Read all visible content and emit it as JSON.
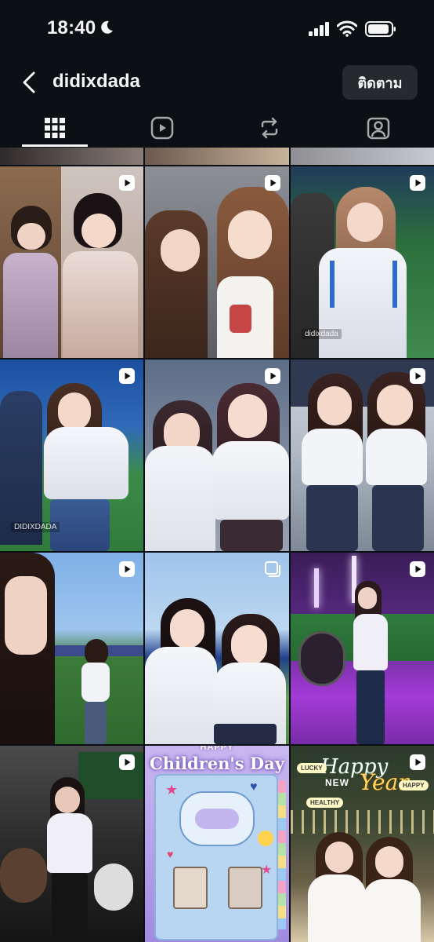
{
  "status_bar": {
    "time": "18:40"
  },
  "header": {
    "username": "didixdada",
    "follow_label": "ติดตาม"
  },
  "tabs": [
    {
      "id": "posts",
      "icon": "grid-icon",
      "active": true
    },
    {
      "id": "reels",
      "icon": "reels-icon",
      "active": false
    },
    {
      "id": "reposts",
      "icon": "repost-icon",
      "active": false
    },
    {
      "id": "tagged",
      "icon": "tagged-person-icon",
      "active": false
    }
  ],
  "posts": [
    {
      "type": "reel",
      "colors": [
        "#d7cdc9",
        "#8a6a52"
      ],
      "caption": ""
    },
    {
      "type": "reel",
      "colors": [
        "#c9b9ae",
        "#7d6b62"
      ],
      "caption": ""
    },
    {
      "type": "reel",
      "colors": [
        "#2c6f3d",
        "#d9dce6"
      ],
      "caption": "didixdada"
    },
    {
      "type": "reel",
      "colors": [
        "#1c4fa0",
        "#3c8a4a"
      ],
      "caption": "DIDIXDADA"
    },
    {
      "type": "reel",
      "colors": [
        "#5e6d86",
        "#e8e8ee"
      ],
      "caption": ""
    },
    {
      "type": "reel",
      "colors": [
        "#cfd6de",
        "#2f3a52"
      ],
      "caption": ""
    },
    {
      "type": "reel",
      "colors": [
        "#7fb0e6",
        "#3c7a3a"
      ],
      "caption": ""
    },
    {
      "type": "carousel",
      "colors": [
        "#9fc4ea",
        "#1f3f8a"
      ],
      "caption": ""
    },
    {
      "type": "reel",
      "colors": [
        "#3a1d57",
        "#a33ad6"
      ],
      "caption": ""
    },
    {
      "type": "reel",
      "colors": [
        "#4b4b4b",
        "#141414"
      ],
      "caption": ""
    },
    {
      "type": "image",
      "colors": [
        "#c8b7f0",
        "#9f8ae0"
      ],
      "caption": "Children's Day",
      "overlay_happy": "HAPPY",
      "overlay_title": "Children's Day"
    },
    {
      "type": "reel",
      "colors": [
        "#2b3a2a",
        "#d8c9a8"
      ],
      "caption": "",
      "overlay_happy": "Happy",
      "overlay_new": "NEW",
      "overlay_year": "Year",
      "tags": [
        "LUCKY",
        "HAPPY",
        "HEALTHY"
      ]
    }
  ]
}
